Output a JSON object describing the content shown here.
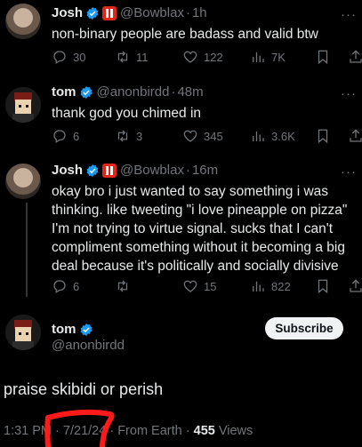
{
  "tweets": [
    {
      "name": "Josh",
      "handle": "@Bowblax",
      "time": "1h",
      "text": "non-binary people are badass and valid btw",
      "replies": "30",
      "retweets": "11",
      "likes": "122",
      "views": "7K"
    },
    {
      "name": "tom",
      "handle": "@anonbirdd",
      "time": "48m",
      "text": "thank god you chimed in",
      "replies": "6",
      "retweets": "3",
      "likes": "345",
      "views": "3.6K"
    },
    {
      "name": "Josh",
      "handle": "@Bowblax",
      "time": "16m",
      "text": "okay bro i just wanted to say something i was thinking. like tweeting \"i love pineapple on pizza\" I'm not trying to virtue signal. sucks that I can't compliment something without it becoming a big deal because it's politically and socially divisive",
      "replies": "6",
      "retweets": "",
      "likes": "15",
      "views": "822"
    }
  ],
  "main": {
    "name": "tom",
    "handle": "@anonbirdd",
    "subscribe_label": "Subscribe",
    "text": "praise skibidi or perish",
    "time": "1:31 PM",
    "date": "7/21/24",
    "source": "From Earth",
    "views_count": "455",
    "views_label": "Views"
  },
  "more_glyph": "···",
  "separator": "·",
  "colors": {
    "background": "#000000",
    "text": "#e7e9ea",
    "muted": "#71767b",
    "verified": "#1d9bf0",
    "affiliate_red": "#e0251b",
    "annotation_red": "#ff1a1a"
  }
}
